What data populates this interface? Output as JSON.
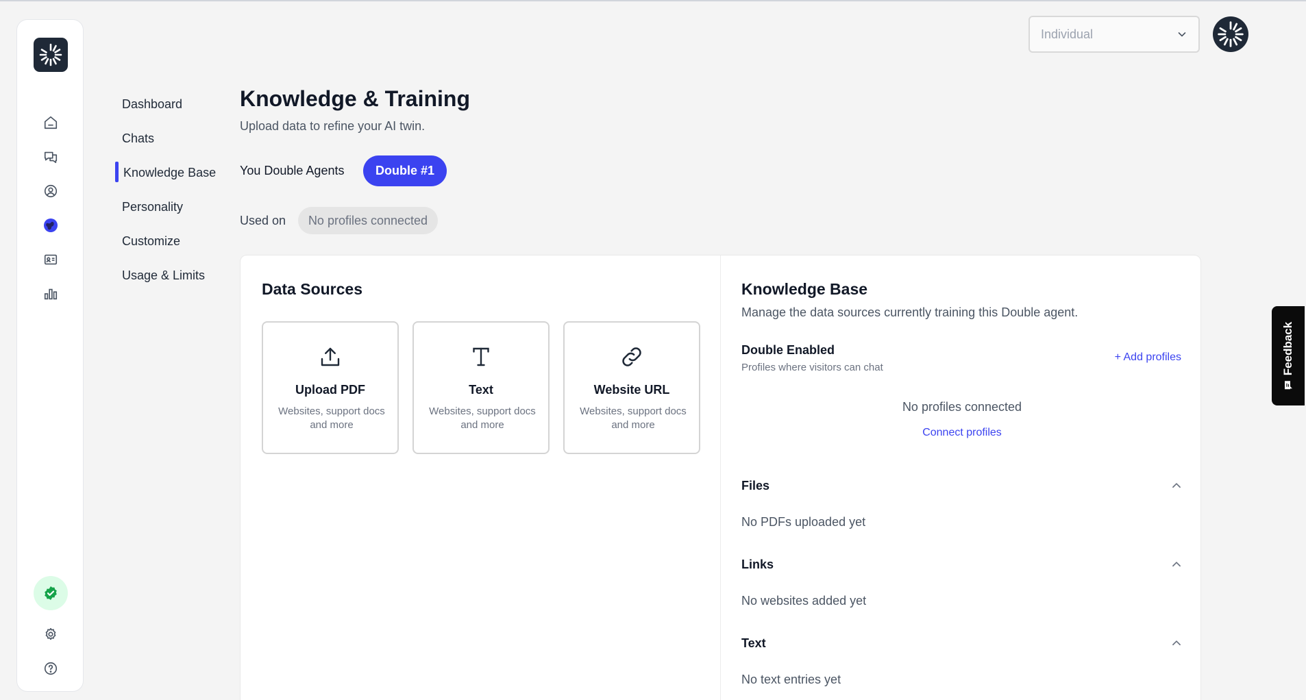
{
  "header": {
    "account_select": {
      "value": "Individual"
    }
  },
  "sidebar": {
    "icons": [
      "home-icon",
      "chats-icon",
      "profile-icon",
      "globe-icon",
      "id-card-icon",
      "bar-chart-icon",
      "verified-badge-icon",
      "settings-icon",
      "help-icon"
    ]
  },
  "subnav": {
    "items": [
      {
        "label": "Dashboard"
      },
      {
        "label": "Chats"
      },
      {
        "label": "Knowledge Base",
        "active": true
      },
      {
        "label": "Personality"
      },
      {
        "label": "Customize"
      },
      {
        "label": "Usage & Limits"
      }
    ]
  },
  "page": {
    "title": "Knowledge & Training",
    "subtitle": "Upload data to refine your AI twin.",
    "agents_label": "You Double Agents",
    "active_agent": "Double #1",
    "used_on_label": "Used on",
    "used_on_value": "No profiles connected"
  },
  "data_sources": {
    "title": "Data Sources",
    "tiles": [
      {
        "icon": "upload-icon",
        "title": "Upload PDF",
        "description": "Websites, support docs and more"
      },
      {
        "icon": "text-icon",
        "title": "Text",
        "description": "Websites, support docs and more"
      },
      {
        "icon": "link-icon",
        "title": "Website URL",
        "description": "Websites, support docs and more"
      }
    ]
  },
  "knowledge_base": {
    "title": "Knowledge Base",
    "description": "Manage the data sources currently training this Double agent.",
    "double_enabled": {
      "title": "Double Enabled",
      "subtitle": "Profiles where visitors can chat",
      "add_link": "+ Add profiles",
      "empty_text": "No profiles connected",
      "connect_link": "Connect profiles"
    },
    "sections": [
      {
        "title": "Files",
        "empty": "No PDFs uploaded yet"
      },
      {
        "title": "Links",
        "empty": "No websites added yet"
      },
      {
        "title": "Text",
        "empty": "No text entries yet"
      }
    ]
  },
  "feedback": {
    "label": "Feedback"
  },
  "colors": {
    "accent": "#3b43f0",
    "verified": "#16a34a"
  }
}
